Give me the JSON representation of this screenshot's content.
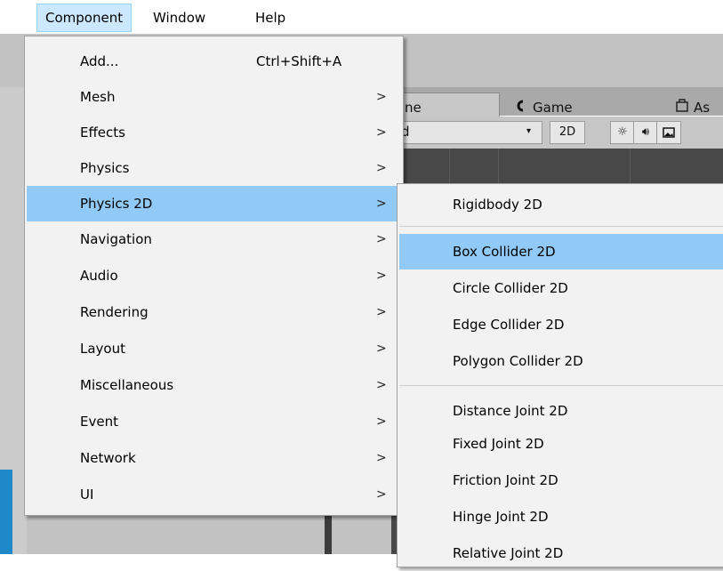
{
  "menubar": {
    "items": [
      "Component",
      "Window",
      "Help"
    ]
  },
  "editor": {
    "tabs": {
      "scene_partial": "ne",
      "game": "Game",
      "assets_partial": "As"
    },
    "toolbar": {
      "shading_partial": "d",
      "mode_2d": "2D"
    }
  },
  "component_menu": {
    "items": [
      {
        "label": "Add...",
        "shortcut": "Ctrl+Shift+A"
      },
      {
        "label": "Mesh"
      },
      {
        "label": "Effects"
      },
      {
        "label": "Physics"
      },
      {
        "label": "Physics 2D",
        "highlighted": true
      },
      {
        "label": "Navigation"
      },
      {
        "label": "Audio"
      },
      {
        "label": "Rendering"
      },
      {
        "label": "Layout"
      },
      {
        "label": "Miscellaneous"
      },
      {
        "label": "Event"
      },
      {
        "label": "Network"
      },
      {
        "label": "UI"
      }
    ],
    "arrow_glyph": ">"
  },
  "physics2d_submenu": {
    "items": [
      {
        "label": "Rigidbody 2D"
      },
      {
        "label": "Box Collider 2D",
        "highlighted": true
      },
      {
        "label": "Circle Collider 2D"
      },
      {
        "label": "Edge Collider 2D"
      },
      {
        "label": "Polygon Collider 2D"
      },
      {
        "label": "Distance Joint 2D"
      },
      {
        "label": "Fixed Joint 2D"
      },
      {
        "label": "Friction Joint 2D"
      },
      {
        "label": "Hinge Joint 2D"
      },
      {
        "label": "Relative Joint 2D"
      }
    ]
  },
  "colors": {
    "highlight": "#91c9f7",
    "menubar_active": "#cce8ff",
    "menu_bg": "#f2f2f2",
    "scene_bg": "#484848"
  }
}
